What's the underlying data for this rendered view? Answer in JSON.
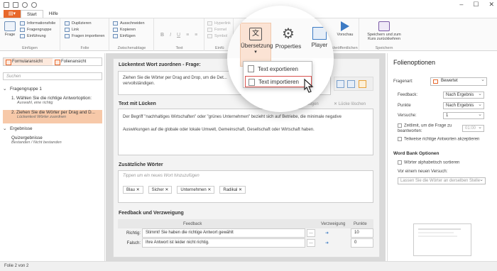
{
  "titlebar": {
    "icons": [
      "new-file-icon",
      "save-icon",
      "undo-icon",
      "redo-icon"
    ]
  },
  "tabs": {
    "start": "Start",
    "hilfe": "Hilfe"
  },
  "ribbon": {
    "frage": "Frage",
    "einfuegen_items": [
      "Informationsfolie",
      "Fragengruppe",
      "Einführung"
    ],
    "einfuegen_label": "Einfügen",
    "folie_items": [
      "Duplizieren",
      "Link",
      "Fragen importieren"
    ],
    "folie_label": "Folie",
    "clipboard_items": [
      "Ausschneiden",
      "Kopieren",
      "Einfügen"
    ],
    "clipboard_label": "Zwischenablage",
    "text_label": "Text",
    "hyperlink_items": [
      "Hyperlink",
      "Formel",
      "Symbol"
    ],
    "einf_label": "Einfü",
    "magnified": {
      "uebersetzung": "Übersetzung",
      "properties": "Properties",
      "player": "Player"
    },
    "vorschau": "Vorschau",
    "veroeffentlichen_label": "Veröffentlichen",
    "speichern_btn": "Speichern und zum Kurs zurückkehren",
    "speichern_label": "Speichern"
  },
  "popup": {
    "export": "Text exportieren",
    "import": "Text importieren"
  },
  "left": {
    "tab_formular": "Formularansicht",
    "tab_folien": "Folienansicht",
    "search_placeholder": "Suchen",
    "group1": "Fragengruppe 1",
    "q1_title": "1. Wählen Sie die richtige Antwortoption:",
    "q1_sub": "Auswahl, eine richtig",
    "q2_title": "2. Ziehen Sie die Wörter per Drag and D...",
    "q2_sub": "Lückentext Wörter zuordnen",
    "group2": "Ergebnisse",
    "result_title": "Quizergebnisse",
    "result_sub": "Bestanden / Nicht bestanden"
  },
  "center": {
    "frage_title": "Lückentext Wort zuordnen - Frage:",
    "frage_text": "Ziehen Sie die Wörter per Drag and Drop, um die Det... vervollständigen.",
    "luecken_title": "Text mit Lücken",
    "luecke_hinzu": "Lücke hinzufügen",
    "luecke_loeschen": "Lücke löschen",
    "luecken_text1": "Der Begriff \"nachhaltiges Wirtschaften\" oder \"grünes Unternehmen\" bezieht sich auf Betriebe, die minimale negative",
    "luecken_text2": "Auswirkungen auf die globale oder lokale Umwelt, Gemeinschaft, Gesellschaft oder Wirtschaft haben.",
    "zusatz_title": "Zusätzliche Wörter",
    "zusatz_placeholder": "Tippen um ein neues Wort hinzuzufügen",
    "words": [
      "Blau",
      "Sicher",
      "Unternehmen",
      "Radikal"
    ],
    "feedback_title": "Feedback und Verzweigung",
    "fb_header_feedback": "Feedback",
    "fb_header_verzweigung": "Verzweigung",
    "fb_header_punkte": "Punkte",
    "fb_rows": [
      {
        "label": "Richtig:",
        "text": "Stimmt! Sie haben die richtige Antwort gewählt",
        "points": "10"
      },
      {
        "label": "Falsch:",
        "text": "Ihre Antwort ist leider nicht richtig.",
        "points": "0"
      }
    ]
  },
  "right": {
    "title": "Folienoptionen",
    "fragenart_label": "Fragenart:",
    "fragenart_value": "Bewertet",
    "feedback_label": "Feedback:",
    "feedback_value": "Nach Ergebnis",
    "punkte_label": "Punkte",
    "punkte_value": "Nach Ergebnis",
    "versuche_label": "Versuche:",
    "versuche_value": "1",
    "zeitlimit": "Zeitlimit, um die Frage zu beantworten:",
    "zeitlimit_value": "01:00",
    "teilweise": "Teilweise richtige Antworten akzeptieren",
    "wordbank_title": "Word Bank Optionen",
    "alphabetisch": "Wörter alphabetisch sortieren",
    "vor_versuch": "Vor einem neuen Versuch:",
    "vor_versuch_value": "Lassen Sie die Wörter an derselben Stelle"
  },
  "status": {
    "slide": "Folie 2 von 2"
  },
  "colors": {
    "accent": "#e8682b",
    "selection": "#f7c9a9",
    "highlight": "#d9534f"
  }
}
